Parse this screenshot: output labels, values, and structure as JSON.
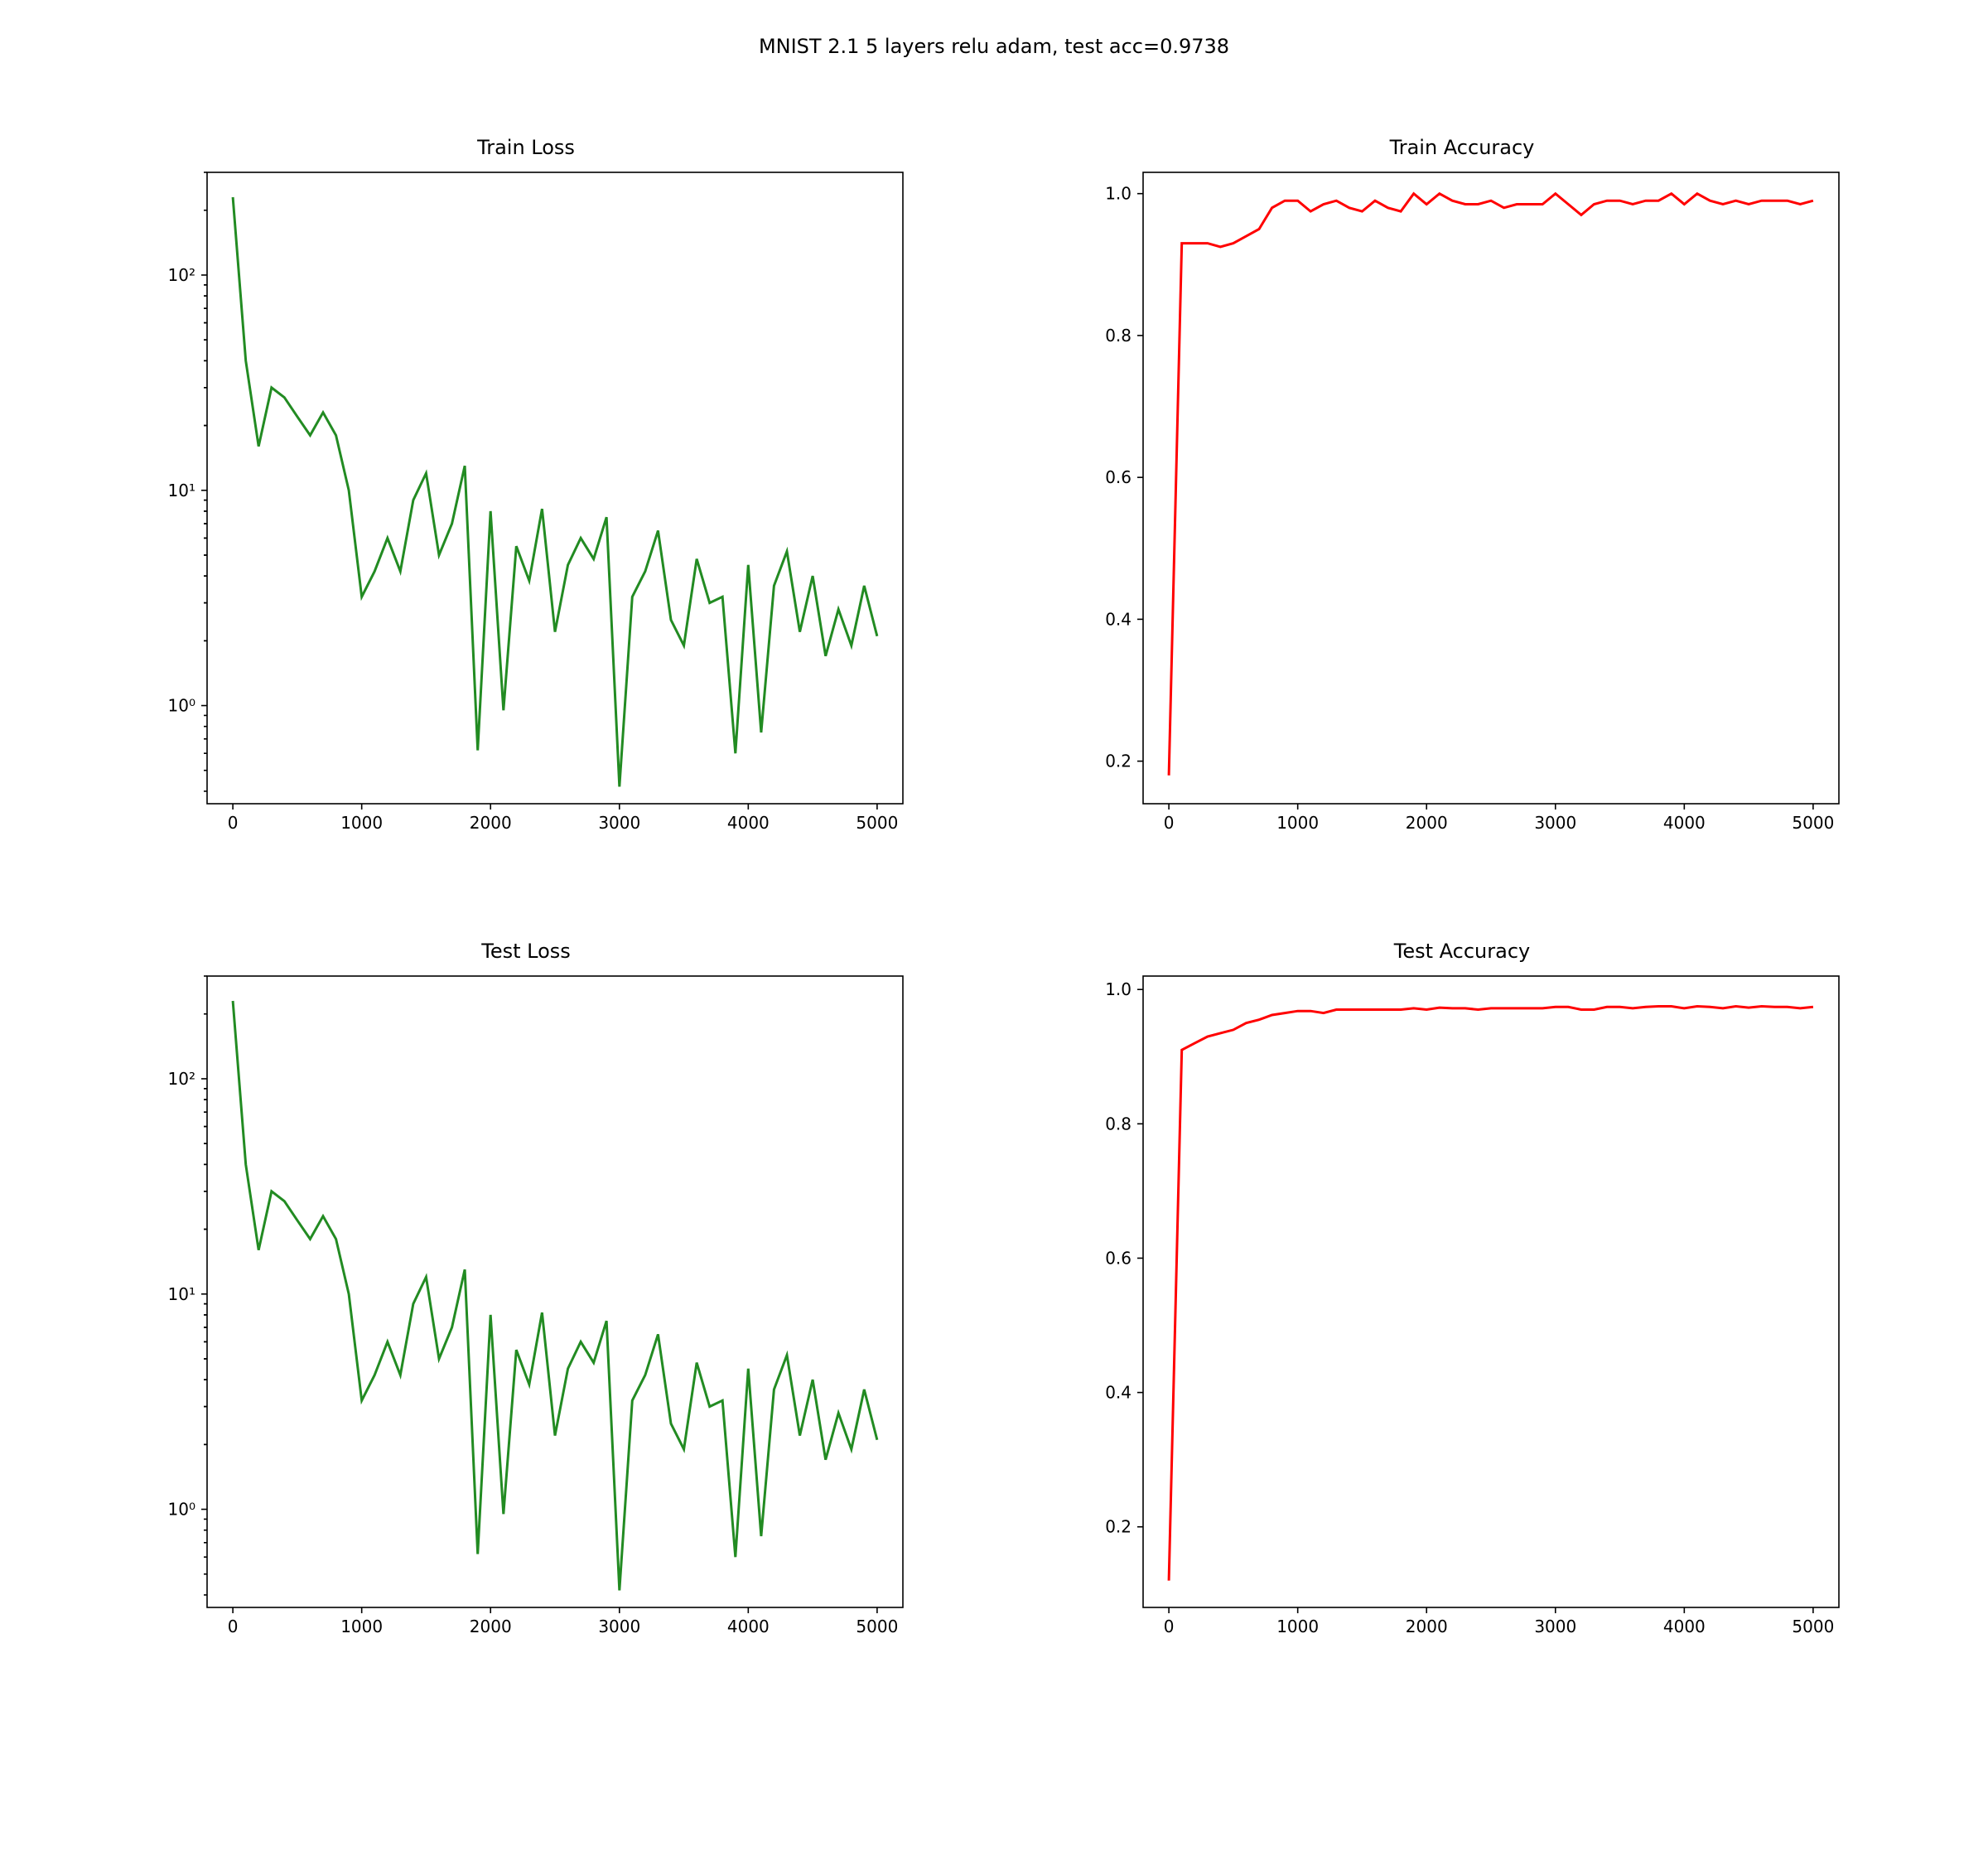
{
  "suptitle": "MNIST 2.1 5 layers relu adam, test acc=0.9738",
  "subplots": {
    "train_loss": {
      "title": "Train Loss"
    },
    "train_acc": {
      "title": "Train Accuracy"
    },
    "test_loss": {
      "title": "Test Loss"
    },
    "test_acc": {
      "title": "Test Accuracy"
    }
  },
  "axes": {
    "x_ticks": [
      0,
      1000,
      2000,
      3000,
      4000,
      5000
    ],
    "loss": {
      "scale": "log",
      "ticks": [
        1,
        10,
        100
      ],
      "tick_labels": [
        "10⁰",
        "10¹",
        "10²"
      ],
      "ylim": [
        0.35,
        300
      ]
    },
    "acc": {
      "scale": "linear",
      "ticks": [
        0.2,
        0.4,
        0.6,
        0.8,
        1.0
      ],
      "train_ylim": [
        0.14,
        1.03
      ],
      "test_ylim": [
        0.08,
        1.02
      ]
    }
  },
  "colors": {
    "loss": "#228B22",
    "acc": "#ff0000"
  },
  "chart_data": [
    {
      "type": "line",
      "title": "Train Loss",
      "xlabel": "",
      "ylabel": "",
      "yscale": "log",
      "x": [
        0,
        100,
        200,
        300,
        400,
        500,
        600,
        700,
        800,
        900,
        1000,
        1100,
        1200,
        1300,
        1400,
        1500,
        1600,
        1700,
        1800,
        1900,
        2000,
        2100,
        2200,
        2300,
        2400,
        2500,
        2600,
        2700,
        2800,
        2900,
        3000,
        3100,
        3200,
        3300,
        3400,
        3500,
        3600,
        3700,
        3800,
        3900,
        4000,
        4100,
        4200,
        4300,
        4400,
        4500,
        4600,
        4700,
        4800,
        4900,
        5000
      ],
      "values": [
        230,
        40,
        16,
        30,
        27,
        22,
        18,
        23,
        18,
        10,
        3.2,
        4.2,
        6.0,
        4.2,
        9.0,
        12,
        5.0,
        7.0,
        13,
        0.62,
        8.0,
        0.95,
        5.5,
        3.8,
        8.2,
        2.2,
        4.5,
        6.0,
        4.8,
        7.5,
        0.42,
        3.2,
        4.2,
        6.5,
        2.5,
        1.9,
        4.8,
        3.0,
        3.2,
        0.6,
        4.5,
        0.75,
        3.6,
        5.2,
        2.2,
        4.0,
        1.7,
        2.8,
        1.9,
        3.6,
        2.1
      ]
    },
    {
      "type": "line",
      "title": "Train Accuracy",
      "xlabel": "",
      "ylabel": "",
      "ylim": [
        0.14,
        1.03
      ],
      "x": [
        0,
        100,
        200,
        300,
        400,
        500,
        600,
        700,
        800,
        900,
        1000,
        1100,
        1200,
        1300,
        1400,
        1500,
        1600,
        1700,
        1800,
        1900,
        2000,
        2100,
        2200,
        2300,
        2400,
        2500,
        2600,
        2700,
        2800,
        2900,
        3000,
        3100,
        3200,
        3300,
        3400,
        3500,
        3600,
        3700,
        3800,
        3900,
        4000,
        4100,
        4200,
        4300,
        4400,
        4500,
        4600,
        4700,
        4800,
        4900,
        5000
      ],
      "values": [
        0.18,
        0.93,
        0.93,
        0.93,
        0.925,
        0.93,
        0.94,
        0.95,
        0.98,
        0.99,
        0.99,
        0.975,
        0.985,
        0.99,
        0.98,
        0.975,
        0.99,
        0.98,
        0.975,
        1.0,
        0.985,
        1.0,
        0.99,
        0.985,
        0.985,
        0.99,
        0.98,
        0.985,
        0.985,
        0.985,
        1.0,
        0.985,
        0.97,
        0.985,
        0.99,
        0.99,
        0.985,
        0.99,
        0.99,
        1.0,
        0.985,
        1.0,
        0.99,
        0.985,
        0.99,
        0.985,
        0.99,
        0.99,
        0.99,
        0.985,
        0.99
      ]
    },
    {
      "type": "line",
      "title": "Test Loss",
      "xlabel": "",
      "ylabel": "",
      "yscale": "log",
      "x": [
        0,
        100,
        200,
        300,
        400,
        500,
        600,
        700,
        800,
        900,
        1000,
        1100,
        1200,
        1300,
        1400,
        1500,
        1600,
        1700,
        1800,
        1900,
        2000,
        2100,
        2200,
        2300,
        2400,
        2500,
        2600,
        2700,
        2800,
        2900,
        3000,
        3100,
        3200,
        3300,
        3400,
        3500,
        3600,
        3700,
        3800,
        3900,
        4000,
        4100,
        4200,
        4300,
        4400,
        4500,
        4600,
        4700,
        4800,
        4900,
        5000
      ],
      "values": [
        230,
        40,
        16,
        30,
        27,
        22,
        18,
        23,
        18,
        10,
        3.2,
        4.2,
        6.0,
        4.2,
        9.0,
        12,
        5.0,
        7.0,
        13,
        0.62,
        8.0,
        0.95,
        5.5,
        3.8,
        8.2,
        2.2,
        4.5,
        6.0,
        4.8,
        7.5,
        0.42,
        3.2,
        4.2,
        6.5,
        2.5,
        1.9,
        4.8,
        3.0,
        3.2,
        0.6,
        4.5,
        0.75,
        3.6,
        5.2,
        2.2,
        4.0,
        1.7,
        2.8,
        1.9,
        3.6,
        2.1
      ]
    },
    {
      "type": "line",
      "title": "Test Accuracy",
      "xlabel": "",
      "ylabel": "",
      "ylim": [
        0.08,
        1.02
      ],
      "x": [
        0,
        100,
        200,
        300,
        400,
        500,
        600,
        700,
        800,
        900,
        1000,
        1100,
        1200,
        1300,
        1400,
        1500,
        1600,
        1700,
        1800,
        1900,
        2000,
        2100,
        2200,
        2300,
        2400,
        2500,
        2600,
        2700,
        2800,
        2900,
        3000,
        3100,
        3200,
        3300,
        3400,
        3500,
        3600,
        3700,
        3800,
        3900,
        4000,
        4100,
        4200,
        4300,
        4400,
        4500,
        4600,
        4700,
        4800,
        4900,
        5000
      ],
      "values": [
        0.12,
        0.91,
        0.92,
        0.93,
        0.935,
        0.94,
        0.95,
        0.955,
        0.962,
        0.965,
        0.968,
        0.968,
        0.965,
        0.97,
        0.97,
        0.97,
        0.97,
        0.97,
        0.97,
        0.972,
        0.97,
        0.973,
        0.972,
        0.972,
        0.97,
        0.972,
        0.972,
        0.972,
        0.972,
        0.972,
        0.974,
        0.974,
        0.97,
        0.97,
        0.974,
        0.974,
        0.972,
        0.974,
        0.975,
        0.975,
        0.972,
        0.975,
        0.974,
        0.972,
        0.975,
        0.973,
        0.975,
        0.974,
        0.974,
        0.972,
        0.974
      ]
    }
  ]
}
